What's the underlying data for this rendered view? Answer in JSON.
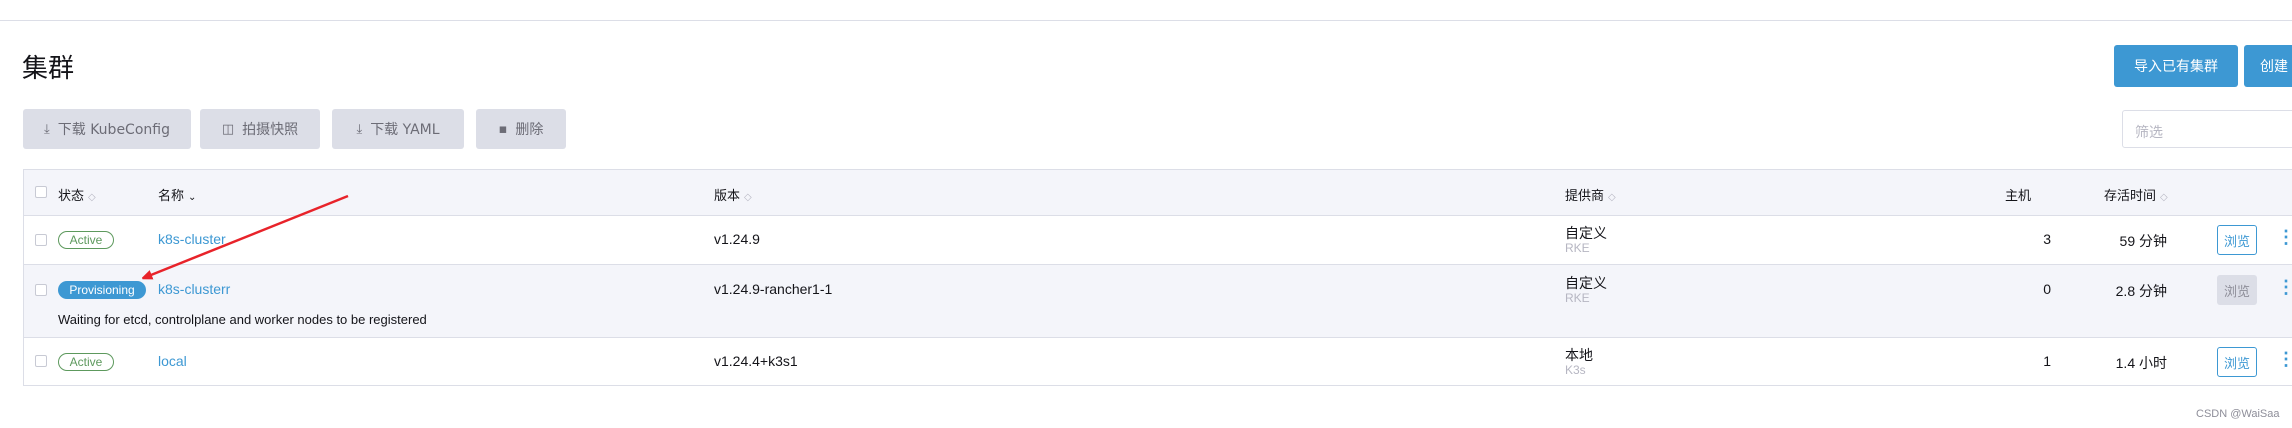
{
  "page": {
    "title": "集群",
    "import_button": "导入已有集群",
    "create_button": "创建",
    "filter_placeholder": "筛选"
  },
  "actions": [
    {
      "icon": "download-icon",
      "label": "下载 KubeConfig"
    },
    {
      "icon": "camera-icon",
      "label": "拍摄快照"
    },
    {
      "icon": "download-icon",
      "label": "下载 YAML"
    },
    {
      "icon": "trash-icon",
      "label": "删除"
    }
  ],
  "table": {
    "columns": {
      "state": "状态",
      "name": "名称",
      "version": "版本",
      "provider": "提供商",
      "machines": "主机",
      "age": "存活时间"
    },
    "rows": [
      {
        "state": "Active",
        "name": "k8s-cluster",
        "version": "v1.24.9",
        "provider": "自定义",
        "provider_sub": "RKE",
        "machines": "3",
        "age": "59 分钟",
        "browse": "浏览"
      },
      {
        "state": "Provisioning",
        "name": "k8s-clusterr",
        "version": "v1.24.9-rancher1-1",
        "provider": "自定义",
        "provider_sub": "RKE",
        "machines": "0",
        "age": "2.8 分钟",
        "browse": "浏览",
        "message": "Waiting for etcd, controlplane and worker nodes to be registered"
      },
      {
        "state": "Active",
        "name": "local",
        "version": "v1.24.4+k3s1",
        "provider": "本地",
        "provider_sub": "K3s",
        "machines": "1",
        "age": "1.4 小时",
        "browse": "浏览"
      }
    ]
  },
  "watermark": "CSDN @WaiSaa",
  "colors": {
    "accent": "#3d98d3",
    "active": "#5d995d",
    "annotation_arrow": "#e8232a"
  }
}
